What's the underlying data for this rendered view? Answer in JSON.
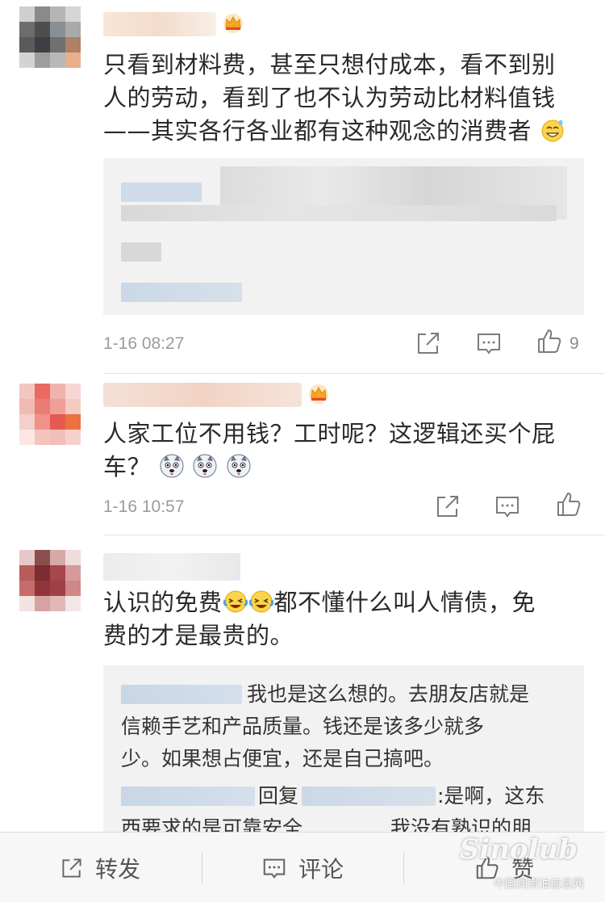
{
  "comments": [
    {
      "text_lines": [
        "只看到材料费，甚至只想付成本，看不到别",
        "人的劳动，看到了也不认为劳动比材料值钱",
        "——其实各行各业都有这种观念的消费者"
      ],
      "emoji": "grinning-sweat-emoji",
      "time": "1-16 08:27",
      "likes": "9"
    },
    {
      "text_lines": [
        "人家工位不用钱？工时呢？这逻辑还买个屁",
        "车？"
      ],
      "emoji": "husky-dog-emoji",
      "time": "1-16 10:57",
      "likes": ""
    },
    {
      "text_line1_before": "认识的免费",
      "text_line1_after": "都不懂什么叫人情债，免",
      "text_line2": "费的才是最贵的。",
      "emoji": "laughing-tears-emoji",
      "replies": {
        "first": [
          "我也是这么想的。去朋友店就是",
          "信赖手艺和产品质量。钱还是该多少就多",
          "少。如果想占便宜，还是自己搞吧。"
        ],
        "second_reply_word": "回复",
        "second_after": ":是啊，这东",
        "second_line2_a": "西要求的是可靠安全",
        "second_line2_b": "我没有熟识的朋"
      }
    }
  ],
  "bottom_bar": {
    "forward": "转发",
    "comment": "评论",
    "like": "赞"
  },
  "watermark": {
    "brand": "Sinolub",
    "sub": "中国润滑油信息网"
  },
  "colors": {
    "gold": "#f5a623",
    "crown_red": "#e8452c",
    "blur_blue": "#c9d7e6",
    "blur_gray": "#d9d9d9"
  }
}
